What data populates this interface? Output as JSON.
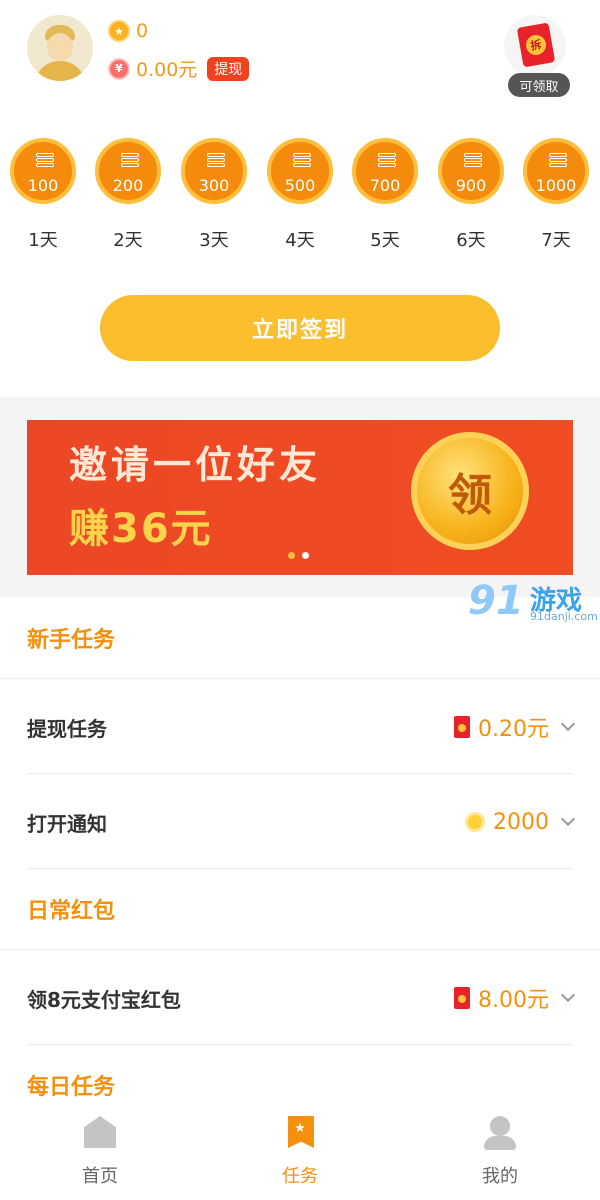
{
  "header": {
    "points": "0",
    "money": "0.00元",
    "withdraw_label": "提现",
    "redpack_seal": "拆",
    "redpack_label": "可领取"
  },
  "checkin": {
    "days": [
      {
        "amount": "100",
        "label": "1天"
      },
      {
        "amount": "200",
        "label": "2天"
      },
      {
        "amount": "300",
        "label": "3天"
      },
      {
        "amount": "500",
        "label": "4天"
      },
      {
        "amount": "700",
        "label": "5天"
      },
      {
        "amount": "900",
        "label": "6天"
      },
      {
        "amount": "1000",
        "label": "7天"
      }
    ],
    "button_label": "立即签到"
  },
  "banner": {
    "line1": "邀请一位好友",
    "line2": "赚36元",
    "coin_text": "领",
    "active_dot": 0
  },
  "watermark": {
    "logo_num": "91",
    "logo_text": "游戏",
    "logo_url": "91danji.com"
  },
  "sections": {
    "newbie": {
      "title": "新手任务",
      "tasks": [
        {
          "name": "提现任务",
          "reward_icon": "red-packet-icon",
          "reward": "0.20元"
        },
        {
          "name": "打开通知",
          "reward_icon": "coin-icon",
          "reward": "2000"
        }
      ]
    },
    "daily_redpack": {
      "title": "日常红包",
      "tasks": [
        {
          "name": "领8元支付宝红包",
          "reward_icon": "red-packet-icon",
          "reward": "8.00元"
        }
      ]
    },
    "daily_task": {
      "title": "每日任务"
    }
  },
  "nav": {
    "items": [
      {
        "label": "首页",
        "icon": "home-icon",
        "active": false
      },
      {
        "label": "任务",
        "icon": "task-icon",
        "active": true
      },
      {
        "label": "我的",
        "icon": "user-icon",
        "active": false
      }
    ]
  },
  "colors": {
    "accent": "#f5900c",
    "button": "#fbbe2d",
    "banner": "#ec4725",
    "nav_inactive": "#666666"
  }
}
